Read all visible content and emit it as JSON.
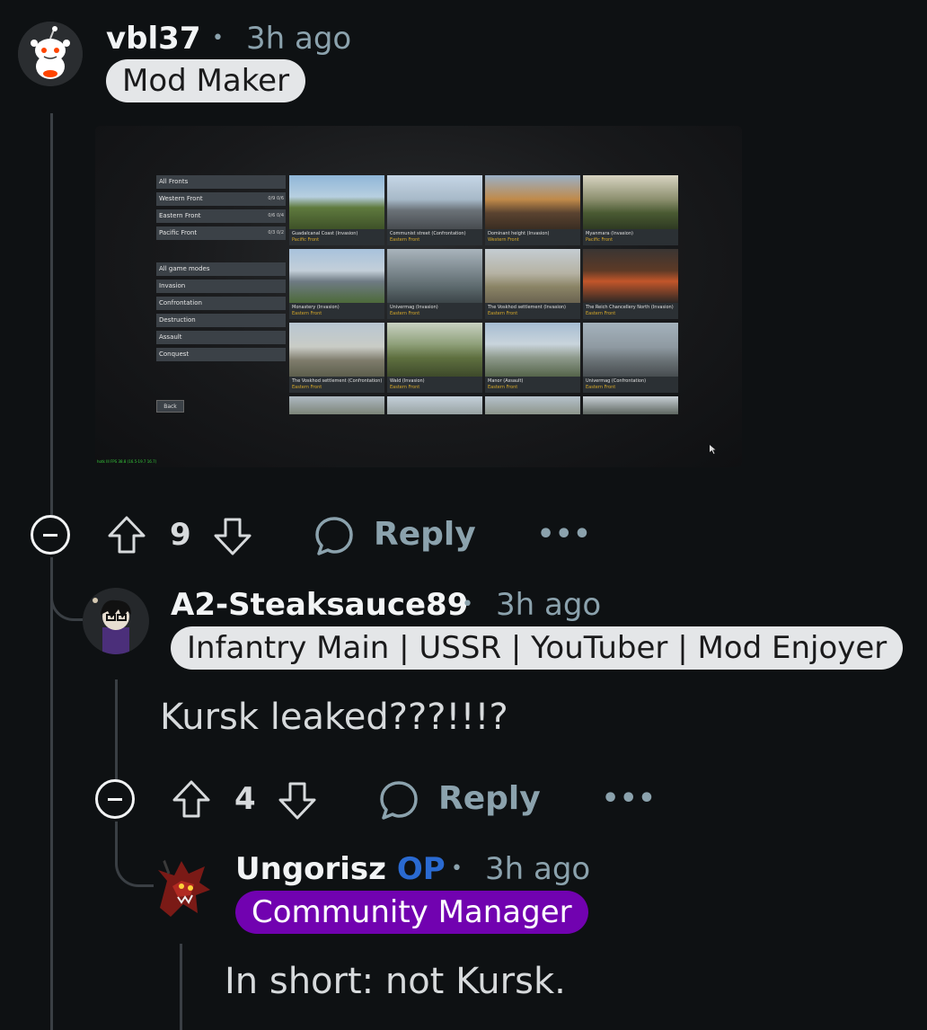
{
  "comments": [
    {
      "username": "vbl37",
      "dot": "•",
      "time": "3h ago",
      "flair": "Mod Maker",
      "score": "9",
      "reply_label": "Reply",
      "more": "•••"
    },
    {
      "username": "A2-Steaksauce89",
      "dot": "•",
      "time": "3h ago",
      "flair": "Infantry Main | USSR | YouTuber | Mod Enjoyer",
      "body": "Kursk leaked???!!!?",
      "score": "4",
      "reply_label": "Reply",
      "more": "•••"
    },
    {
      "username": "Ungorisz",
      "op_badge": "OP",
      "dot": "•",
      "time": "3h ago",
      "flair": "Community Manager",
      "body": "In short: not Kursk."
    }
  ],
  "screenshot": {
    "fronts": [
      {
        "label": "All Fronts",
        "counts": ""
      },
      {
        "label": "Western Front",
        "counts": "0/9  0/6"
      },
      {
        "label": "Eastern Front",
        "counts": "0/6  0/4"
      },
      {
        "label": "Pacific Front",
        "counts": "0/3  0/2"
      }
    ],
    "modes": [
      "All game modes",
      "Invasion",
      "Confrontation",
      "Destruction",
      "Assault",
      "Conquest"
    ],
    "back_label": "Back",
    "fps_text": "hotk III FPS 38.8 (16.5-19.7 16.7)",
    "maps": [
      {
        "name": "Guadalcanal Coast (Invasion)",
        "front": "Pacific Front"
      },
      {
        "name": "Communist street (Confrontation)",
        "front": "Eastern Front"
      },
      {
        "name": "Dominant height (Invasion)",
        "front": "Western Front"
      },
      {
        "name": "Myanmara (Invasion)",
        "front": "Pacific Front"
      },
      {
        "name": "Monastery (Invasion)",
        "front": "Eastern Front"
      },
      {
        "name": "Univermag (Invasion)",
        "front": "Eastern Front"
      },
      {
        "name": "The Voskhod settlement (Invasion)",
        "front": "Eastern Front"
      },
      {
        "name": "The Reich Chancellery North (Invasion)",
        "front": "Eastern Front"
      },
      {
        "name": "The Voskhod settlement (Confrontation)",
        "front": "Eastern Front"
      },
      {
        "name": "Wald (Invasion)",
        "front": "Eastern Front"
      },
      {
        "name": "Manor (Assault)",
        "front": "Eastern Front"
      },
      {
        "name": "Univermag (Confrontation)",
        "front": "Eastern Front"
      }
    ]
  },
  "colors": {
    "background": "#0e1113",
    "meta": "#8ba2ad",
    "op": "#2a6ad1",
    "flair_purple": "#7102b0",
    "flair_light": "#e4e6e8"
  },
  "icons": [
    "reddit-snoo-avatar",
    "custom-avatar",
    "dragon-avatar",
    "collapse-icon",
    "upvote-icon",
    "downvote-icon",
    "reply-bubble-icon",
    "more-options-icon"
  ]
}
